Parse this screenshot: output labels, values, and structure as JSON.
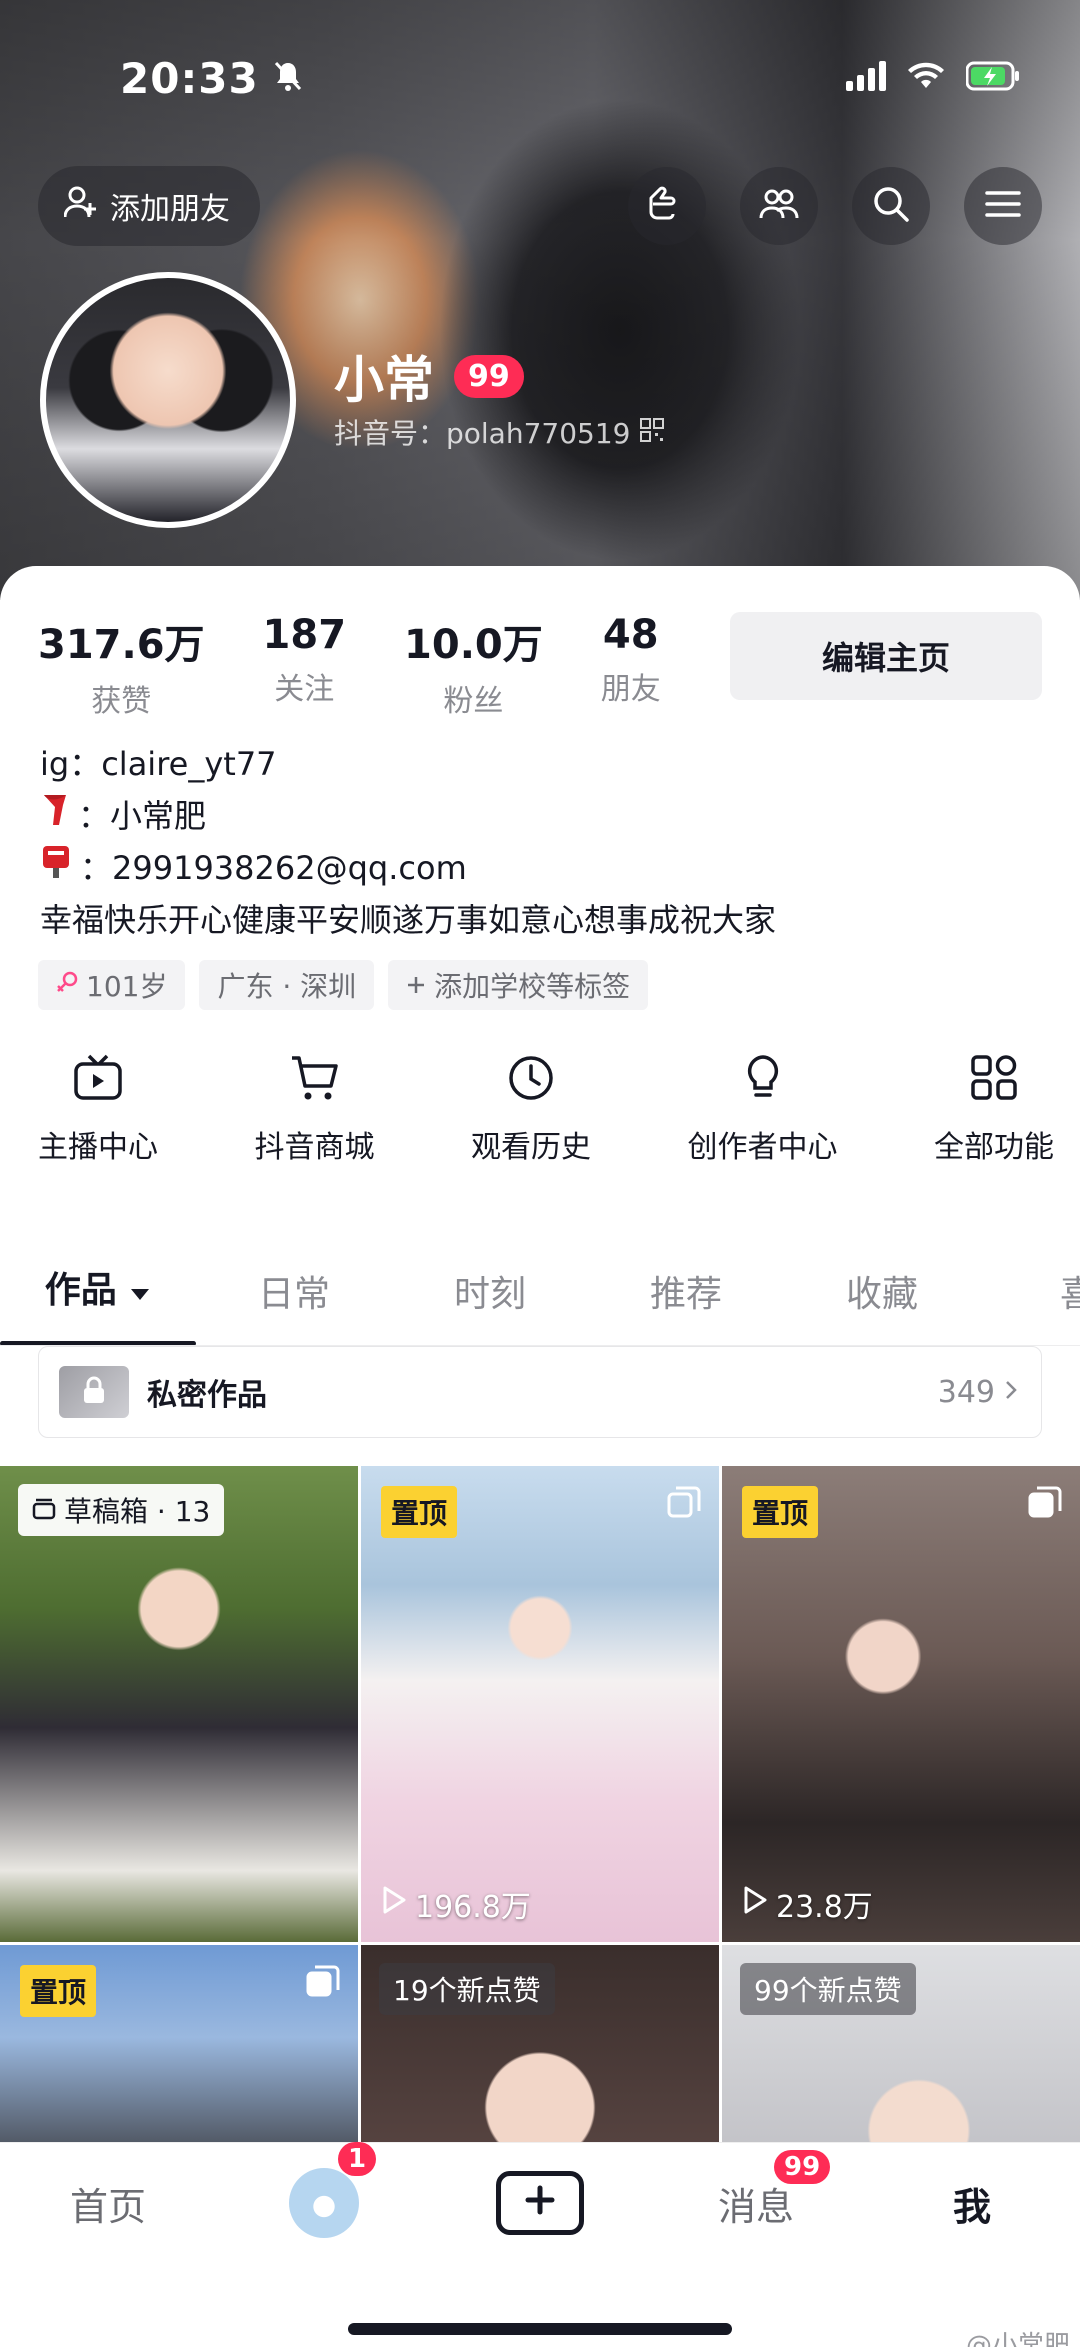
{
  "status": {
    "time": "20:33"
  },
  "header": {
    "add_friend_label": "添加朋友",
    "name": "小常",
    "name_badge": "99",
    "douyin_id": "抖音号：polah770519"
  },
  "stats": [
    {
      "num": "317.6万",
      "label": "获赞"
    },
    {
      "num": "187",
      "label": "关注"
    },
    {
      "num": "10.0万",
      "label": "粉丝"
    },
    {
      "num": "48",
      "label": "朋友"
    }
  ],
  "edit_profile_label": "编辑主页",
  "bio": {
    "ig": "ig：claire_yt77",
    "line2": "：小常肥",
    "line3": "：2991938262@qq.com",
    "line4": "幸福快乐开心健康平安顺遂万事如意心想事成祝大家"
  },
  "tags": [
    "101岁",
    "广东 · 深圳",
    "添加学校等标签"
  ],
  "shortcuts": [
    "主播中心",
    "抖音商城",
    "观看历史",
    "创作者中心",
    "全部功能"
  ],
  "tabs": [
    "作品",
    "日常",
    "时刻",
    "推荐",
    "收藏",
    "喜"
  ],
  "private": {
    "title": "私密作品",
    "count": "349"
  },
  "grid": {
    "draft_label": "草稿箱 · 13",
    "pin_label": "置顶",
    "views_2": "196.8万",
    "views_3": "23.8万",
    "likes_5": "19个新点赞",
    "likes_6": "99个新点赞"
  },
  "bottom_nav": {
    "home": "首页",
    "friends_badge": "1",
    "messages": "消息",
    "messages_badge": "99",
    "me": "我"
  },
  "watermark": "@小常肥"
}
